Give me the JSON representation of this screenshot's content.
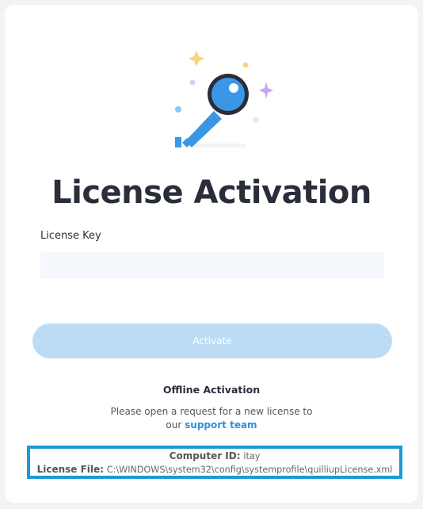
{
  "header": {
    "title": "License Activation"
  },
  "illustration": {
    "icon": "key-magnifier-icon"
  },
  "license_key": {
    "label": "License Key",
    "value": "",
    "placeholder": ""
  },
  "activate_button": {
    "label": "Activate"
  },
  "offline": {
    "title": "Offline Activation",
    "line1": "Please open a request for a new license to",
    "line2_prefix": "our",
    "support_link": "support team"
  },
  "info": {
    "computer_id_label": "Computer ID:",
    "computer_id_value": "itay",
    "license_file_label": "License File:",
    "license_file_value": "C:\\WINDOWS\\system32\\config\\systemprofile\\quilliupLicense.xml"
  },
  "colors": {
    "accent": "#2f8fd8",
    "button_disabled": "#bcdcf5",
    "highlight_border": "#1a9ad6",
    "title": "#2a2d3a"
  }
}
